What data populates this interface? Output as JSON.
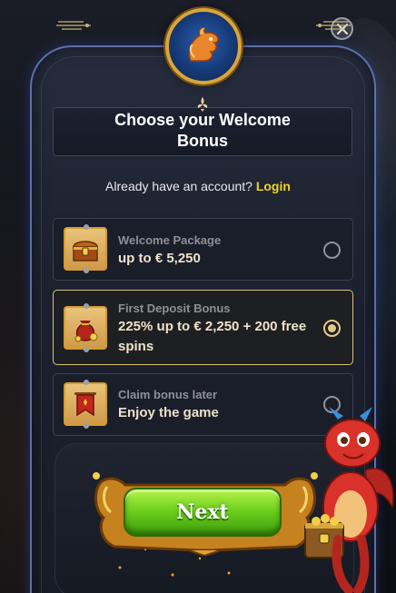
{
  "modal": {
    "title": "Choose your Welcome Bonus",
    "account_prompt": "Already have an account?",
    "login_label": "Login",
    "next_label": "Next"
  },
  "options": [
    {
      "kicker": "Welcome Package",
      "main": "up to € 5,250",
      "selected": false,
      "icon": "treasure-chest-icon"
    },
    {
      "kicker": "First Deposit Bonus",
      "main": "225% up to € 2,250 + 200 free spins",
      "selected": true,
      "icon": "money-bag-icon"
    },
    {
      "kicker": "Claim bonus later",
      "main": "Enjoy the game",
      "selected": false,
      "icon": "banner-flag-icon"
    }
  ],
  "colors": {
    "accent_gold": "#d8a63a",
    "login_yellow": "#f2d226",
    "next_green": "#6fd11e",
    "panel_border": "#5d6fa8"
  }
}
